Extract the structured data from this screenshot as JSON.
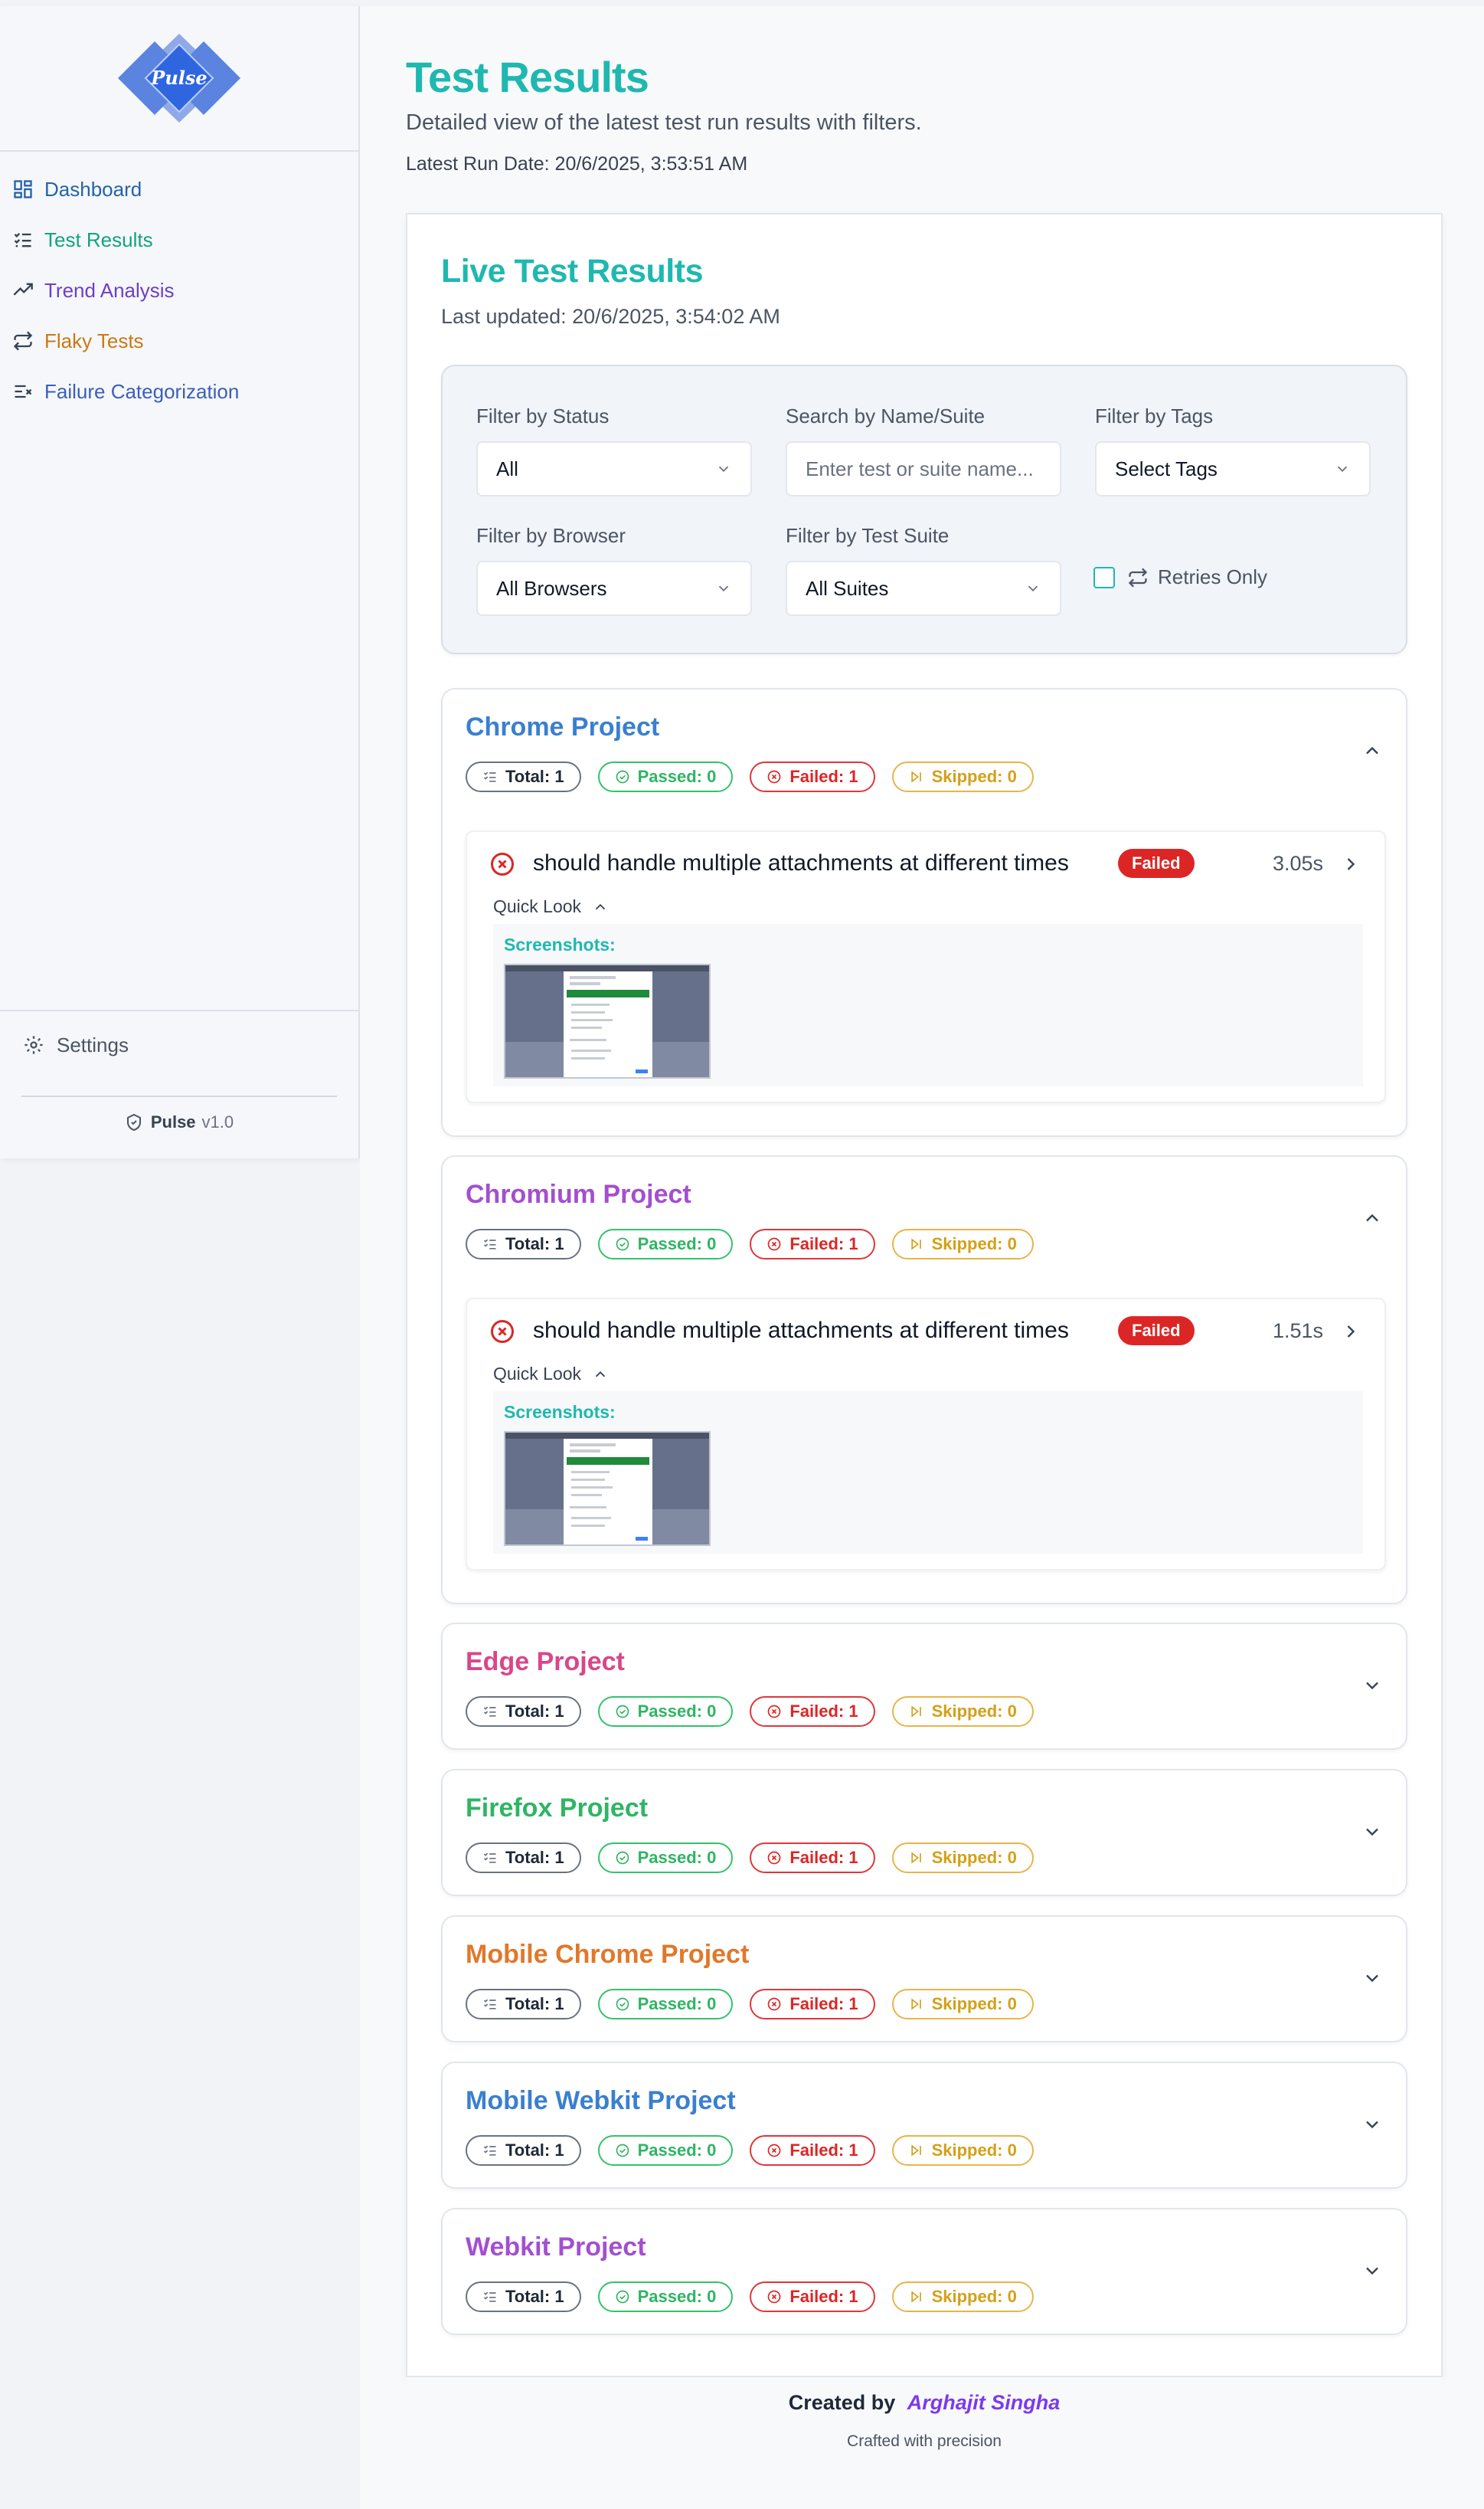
{
  "brand": {
    "logo_text": "Pulse",
    "name": "Pulse",
    "version": "v1.0"
  },
  "sidebar": {
    "items": [
      {
        "label": "Dashboard",
        "icon": "dashboard-icon",
        "color": "#2563a6"
      },
      {
        "label": "Test Results",
        "icon": "list-checks-icon",
        "color": "#14a37f"
      },
      {
        "label": "Trend Analysis",
        "icon": "trending-up-icon",
        "color": "#6d3fc7"
      },
      {
        "label": "Flaky Tests",
        "icon": "repeat-icon",
        "color": "#c97a15"
      },
      {
        "label": "Failure Categorization",
        "icon": "list-x-icon",
        "color": "#3b5fb8"
      }
    ],
    "settings_label": "Settings"
  },
  "header": {
    "title": "Test Results",
    "subtitle": "Detailed view of the latest test run results with filters.",
    "run_date": "Latest Run Date: 20/6/2025, 3:53:51 AM"
  },
  "live": {
    "title": "Live Test Results",
    "last_updated": "Last updated: 20/6/2025, 3:54:02 AM"
  },
  "filters": {
    "status_label": "Filter by Status",
    "status_value": "All",
    "search_label": "Search by Name/Suite",
    "search_placeholder": "Enter test or suite name...",
    "tags_label": "Filter by Tags",
    "tags_value": "Select Tags",
    "browser_label": "Filter by Browser",
    "browser_value": "All Browsers",
    "suite_label": "Filter by Test Suite",
    "suite_value": "All Suites",
    "retries_label": "Retries Only"
  },
  "projects": [
    {
      "name": "Chrome Project",
      "color": "#3a7fd0",
      "total": "Total: 1",
      "passed": "Passed: 0",
      "failed": "Failed: 1",
      "skipped": "Skipped: 0",
      "expanded": true,
      "test": {
        "name": "should handle multiple attachments at different times",
        "status": "Failed",
        "duration": "3.05s",
        "quick_look": "Quick Look",
        "screenshots_label": "Screenshots:"
      }
    },
    {
      "name": "Chromium Project",
      "color": "#a34fcf",
      "total": "Total: 1",
      "passed": "Passed: 0",
      "failed": "Failed: 1",
      "skipped": "Skipped: 0",
      "expanded": true,
      "test": {
        "name": "should handle multiple attachments at different times",
        "status": "Failed",
        "duration": "1.51s",
        "quick_look": "Quick Look",
        "screenshots_label": "Screenshots:"
      }
    },
    {
      "name": "Edge Project",
      "color": "#d9468a",
      "total": "Total: 1",
      "passed": "Passed: 0",
      "failed": "Failed: 1",
      "skipped": "Skipped: 0",
      "expanded": false
    },
    {
      "name": "Firefox Project",
      "color": "#2fb563",
      "total": "Total: 1",
      "passed": "Passed: 0",
      "failed": "Failed: 1",
      "skipped": "Skipped: 0",
      "expanded": false
    },
    {
      "name": "Mobile Chrome Project",
      "color": "#e0782a",
      "total": "Total: 1",
      "passed": "Passed: 0",
      "failed": "Failed: 1",
      "skipped": "Skipped: 0",
      "expanded": false
    },
    {
      "name": "Mobile Webkit Project",
      "color": "#3a7fd0",
      "total": "Total: 1",
      "passed": "Passed: 0",
      "failed": "Failed: 1",
      "skipped": "Skipped: 0",
      "expanded": false
    },
    {
      "name": "Webkit Project",
      "color": "#a34fcf",
      "total": "Total: 1",
      "passed": "Passed: 0",
      "failed": "Failed: 1",
      "skipped": "Skipped: 0",
      "expanded": false
    }
  ],
  "footer": {
    "created_by": "Created by",
    "author": "Arghajit Singha",
    "tagline": "Crafted with precision"
  }
}
